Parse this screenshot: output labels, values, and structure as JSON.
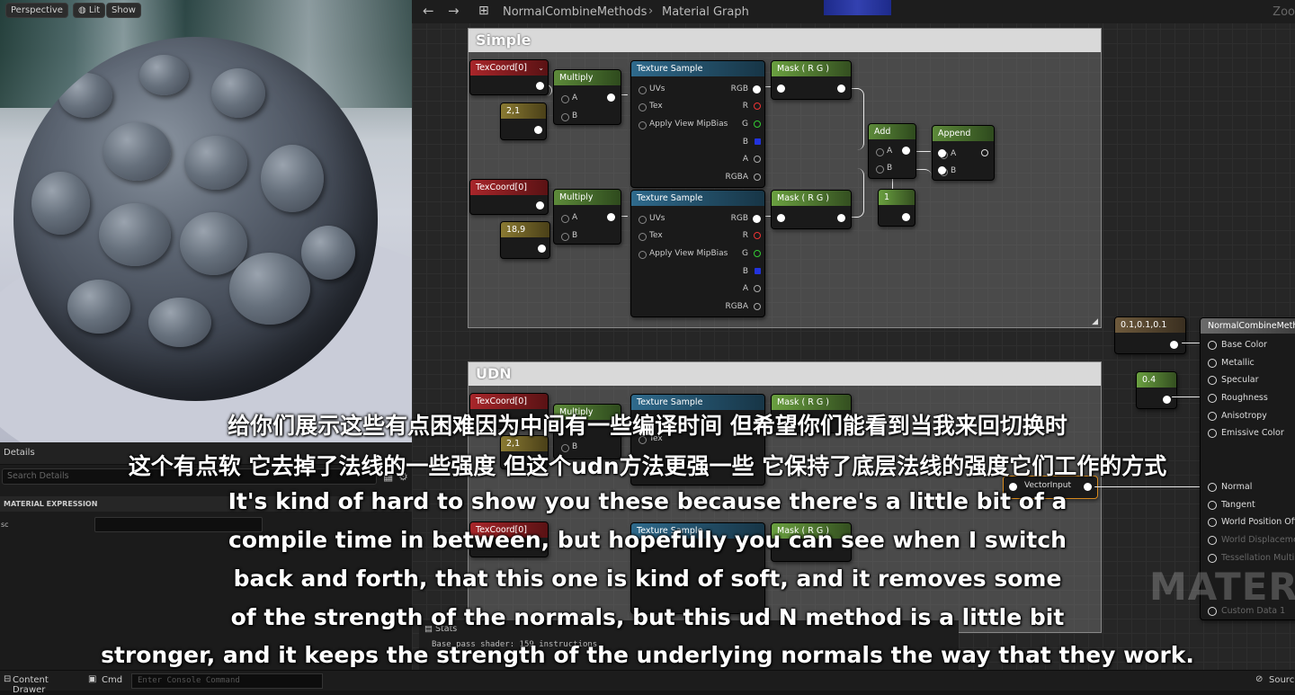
{
  "viewport": {
    "buttons": [
      "Perspective",
      "Lit",
      "Show"
    ]
  },
  "details": {
    "tab": "Details",
    "search_placeholder": "Search Details",
    "section": "MATERIAL EXPRESSION",
    "field_label": "sc"
  },
  "toolbar": {
    "breadcrumb_asset": "NormalCombineMethods",
    "breadcrumb_sep": "›",
    "breadcrumb_view": "Material Graph",
    "zoom": "Zoo"
  },
  "graph": {
    "comment_simple": "Simple",
    "comment_udn": "UDN",
    "texcoord": "TexCoord[0]",
    "multiply": "Multiply",
    "texture_sample": "Texture Sample",
    "mask_rg": "Mask ( R G )",
    "add": "Add",
    "append": "Append",
    "const_a": "2,1",
    "const_b": "18,9",
    "const_one": "1",
    "const_vec": "0.1,0.1,0.1",
    "const_04": "0.4",
    "vector_input": "VectorInput",
    "pins": {
      "a": "A",
      "b": "B",
      "uvs": "UVs",
      "tex": "Tex",
      "apply": "Apply View MipBias",
      "rgb": "RGB",
      "r": "R",
      "g": "G",
      "bb": "B",
      "aa": "A",
      "rgba": "RGBA"
    },
    "result_node": {
      "title": "NormalCombineMeth",
      "inputs": [
        "Base Color",
        "Metallic",
        "Specular",
        "Roughness",
        "Anisotropy",
        "Emissive Color",
        "Normal",
        "Tangent",
        "World Position Offse",
        "World Displacement",
        "Tessellation Multipl",
        "Custom Data 1"
      ]
    },
    "watermark": "MATERIA",
    "stats_tab": "Stats",
    "stats_text": "Base pass shader: 159 instructions"
  },
  "subtitles": {
    "zh_line1": "给你们展示这些有点困难因为中间有一些编译时间 但希望你们能看到当我来回切换时",
    "zh_line2": "这个有点软 它去掉了法线的一些强度 但这个udn方法更强一些 它保持了底层法线的强度它们工作的方式",
    "en_line1": "It's kind of hard to show you these because there's a little bit of a",
    "en_line2": "compile time in between, but hopefully you can see when I switch",
    "en_line3": "back and forth, that this one is kind of soft, and it removes some",
    "en_line4": "of the strength of the normals, but this ud N method is a little bit",
    "en_line5": "stronger, and it keeps the strength of the underlying normals the way that they work."
  },
  "bottombar": {
    "content_drawer": "Content Drawer",
    "cmd": "Cmd",
    "console_placeholder": "Enter Console Command",
    "source": "Sourc"
  }
}
